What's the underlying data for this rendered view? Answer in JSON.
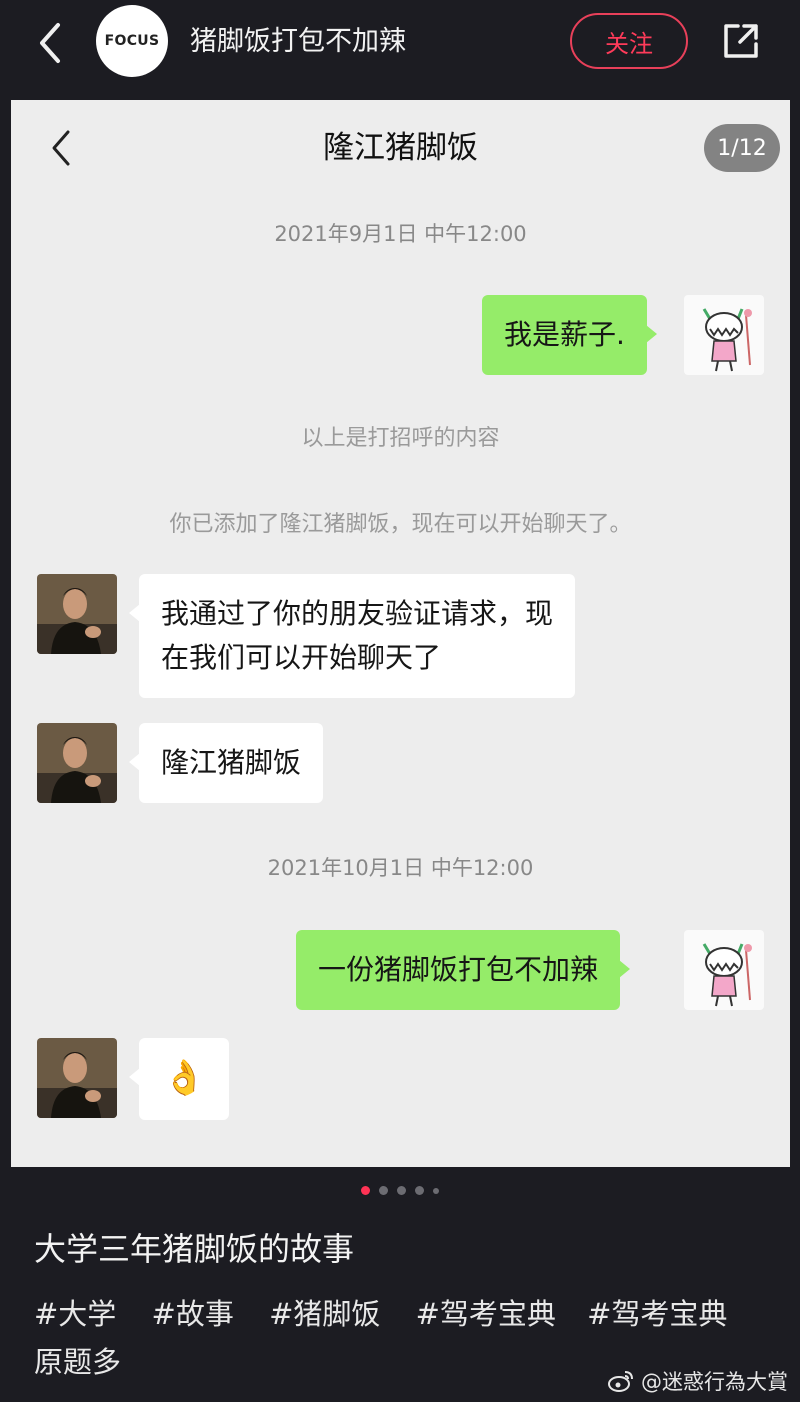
{
  "app_bar": {
    "account_logo": "FOCUS",
    "title": "猪脚饭打包不加辣",
    "follow_label": "关注"
  },
  "chat_screenshot": {
    "contact_name": "隆江猪脚饭",
    "page_counter": "1/12",
    "timestamp_1": "2021年9月1日 中午12:00",
    "msg_me_1": "我是薪子.",
    "sys_greeting": "以上是打招呼的内容",
    "sys_added": "你已添加了隆江猪脚饭，现在可以开始聊天了。",
    "msg_other_1_line1": "我通过了你的朋友验证请求，现",
    "msg_other_1_line2": "在我们可以开始聊天了",
    "msg_other_2": "隆江猪脚饭",
    "timestamp_2": "2021年10月1日 中午12:00",
    "msg_me_2": "一份猪脚饭打包不加辣",
    "msg_other_3": "👌"
  },
  "carousel": {
    "total": 5,
    "active_index": 0
  },
  "post": {
    "title": "大学三年猪脚饭的故事",
    "tags": [
      "#大学",
      "#故事",
      "#猪脚饭",
      "#驾考宝典",
      "#驾考宝典"
    ],
    "tag_continuation": "原题多"
  },
  "watermark": "@迷惑行為大賞",
  "colors": {
    "background": "#1c1c22",
    "follow_accent": "#ff3b5a",
    "bubble_self": "#95ec69",
    "bubble_other": "#ffffff",
    "chat_background": "#ededed"
  },
  "icons": [
    "back-arrow-icon",
    "share-icon",
    "chat-back-icon",
    "user-avatar",
    "contact-avatar",
    "weibo-icon"
  ]
}
